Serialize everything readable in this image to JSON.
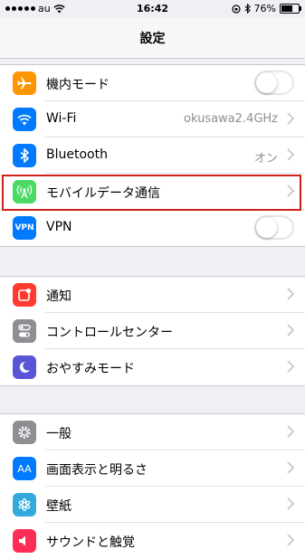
{
  "status": {
    "carrier": "au",
    "time": "16:42",
    "battery": "76%",
    "battery_level": 0.76
  },
  "nav": {
    "title": "設定"
  },
  "group1": [
    {
      "label": "機内モード",
      "icon": "airplane-icon",
      "color": "#ff9500",
      "control": "toggle",
      "on": false
    },
    {
      "label": "Wi-Fi",
      "icon": "wifi-icon",
      "color": "#007aff",
      "value": "okusawa2.4GHz",
      "control": "chevron"
    },
    {
      "label": "Bluetooth",
      "icon": "bluetooth-icon",
      "color": "#007aff",
      "value": "オン",
      "control": "chevron"
    },
    {
      "label": "モバイルデータ通信",
      "icon": "cellular-icon",
      "color": "#4cd964",
      "control": "chevron",
      "highlighted": true
    },
    {
      "label": "VPN",
      "icon": "vpn-icon",
      "icon_text": "VPN",
      "color": "#007aff",
      "control": "toggle",
      "on": false
    }
  ],
  "group2": [
    {
      "label": "通知",
      "icon": "notifications-icon",
      "color": "#ff3b30",
      "control": "chevron"
    },
    {
      "label": "コントロールセンター",
      "icon": "control-center-icon",
      "color": "#8e8e93",
      "control": "chevron"
    },
    {
      "label": "おやすみモード",
      "icon": "moon-icon",
      "color": "#5856d6",
      "control": "chevron"
    }
  ],
  "group3": [
    {
      "label": "一般",
      "icon": "gear-icon",
      "color": "#8e8e93",
      "control": "chevron"
    },
    {
      "label": "画面表示と明るさ",
      "icon": "display-brightness-icon",
      "icon_text": "AA",
      "color": "#007aff",
      "control": "chevron"
    },
    {
      "label": "壁紙",
      "icon": "wallpaper-icon",
      "color": "#34aadc",
      "control": "chevron"
    },
    {
      "label": "サウンドと触覚",
      "icon": "sounds-icon",
      "color": "#ff2d55",
      "control": "chevron"
    }
  ]
}
